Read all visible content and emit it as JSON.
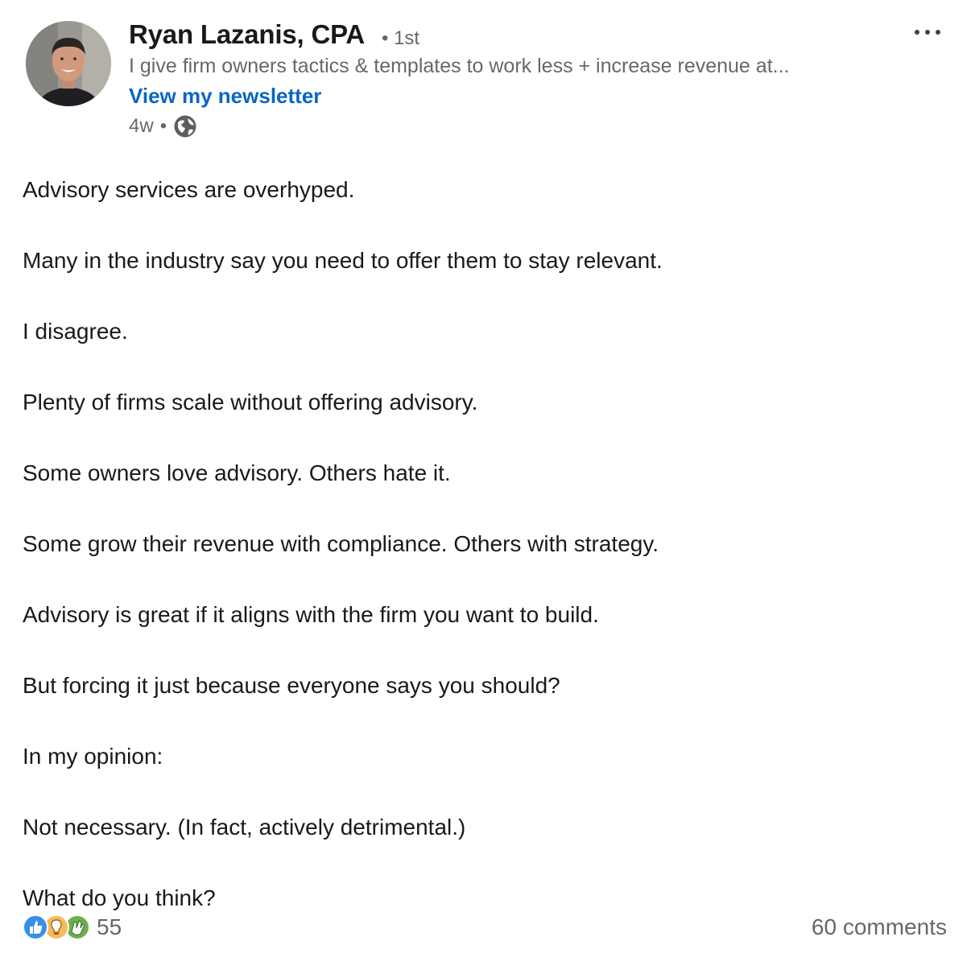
{
  "author": {
    "name": "Ryan Lazanis, CPA",
    "degree": "• 1st",
    "headline": "I give firm owners tactics & templates to work less + increase revenue at...",
    "newsletter_link": "View my newsletter",
    "time": "4w",
    "dot": "•",
    "visibility_icon": "globe-icon"
  },
  "more_icon": "ellipsis-icon",
  "post": {
    "lines": [
      "Advisory services are overhyped.",
      "Many in the industry say you need to offer them to stay relevant.",
      "I disagree.",
      "Plenty of firms scale without offering advisory.",
      "Some owners love advisory. Others hate it.",
      "Some grow their revenue with compliance. Others with strategy.",
      "Advisory is great if it aligns with the firm you want to build.",
      "But forcing it just because everyone says you should?",
      "In my opinion:",
      "Not necessary. (In fact, actively detrimental.)",
      "What do you think?"
    ]
  },
  "social": {
    "reaction_icons": [
      "like-icon",
      "insightful-icon",
      "celebrate-icon"
    ],
    "reaction_count": "55",
    "comments": "60 comments"
  },
  "colors": {
    "link": "#0a66c2",
    "like": "#378fe9",
    "insightful": "#f5bb5c",
    "celebrate": "#6dae4f"
  }
}
